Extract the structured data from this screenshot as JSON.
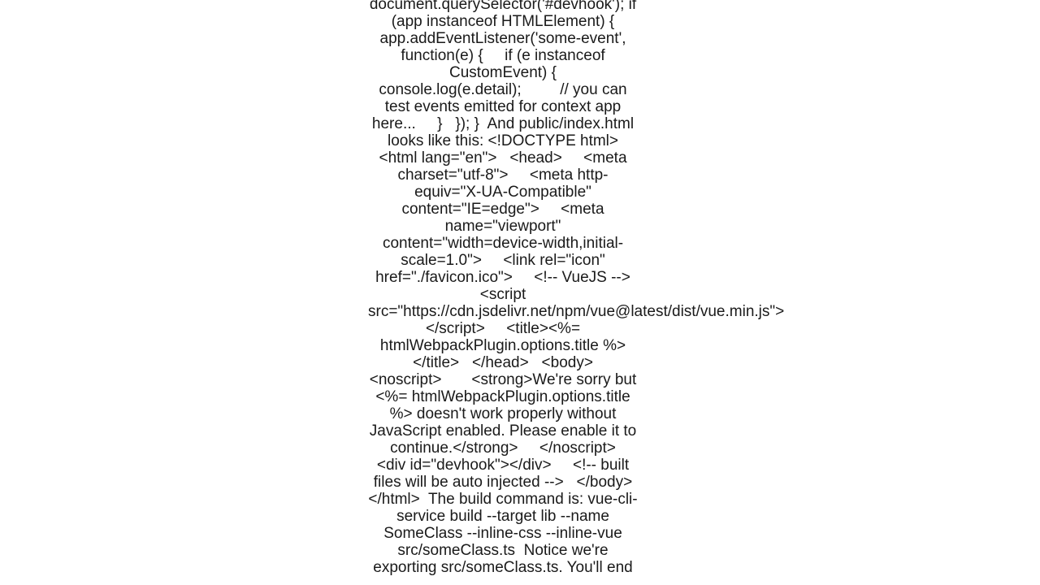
{
  "document": {
    "text": "document.querySelector('#devhook'); if (app instanceof HTMLElement) {     app.addEventListener('some-event', function(e) {     if (e instanceof CustomEvent) {         console.log(e.detail);         // you can test events emitted for context app here...     }   }); }  And public/index.html looks like this: <!DOCTYPE html> <html lang=\"en\">   <head>     <meta charset=\"utf-8\">     <meta http-equiv=\"X-UA-Compatible\" content=\"IE=edge\">     <meta name=\"viewport\" content=\"width=device-width,initial-scale=1.0\">     <link rel=\"icon\" href=\"./favicon.ico\">     <!-- VueJS -->     <script src=\"https://cdn.jsdelivr.net/npm/vue@latest/dist/vue.min.js\"></script>     <title><%= htmlWebpackPlugin.options.title %></title>   </head>   <body>     <noscript>       <strong>We're sorry but <%= htmlWebpackPlugin.options.title %> doesn't work properly without JavaScript enabled. Please enable it to continue.</strong>     </noscript>     <div id=\"devhook\"></div>     <!-- built files will be auto injected -->   </body> </html>  The build command is: vue-cli-service build --target lib --name SomeClass --inline-css --inline-vue src/someClass.ts  Notice we're exporting src/someClass.ts. You'll end"
  }
}
